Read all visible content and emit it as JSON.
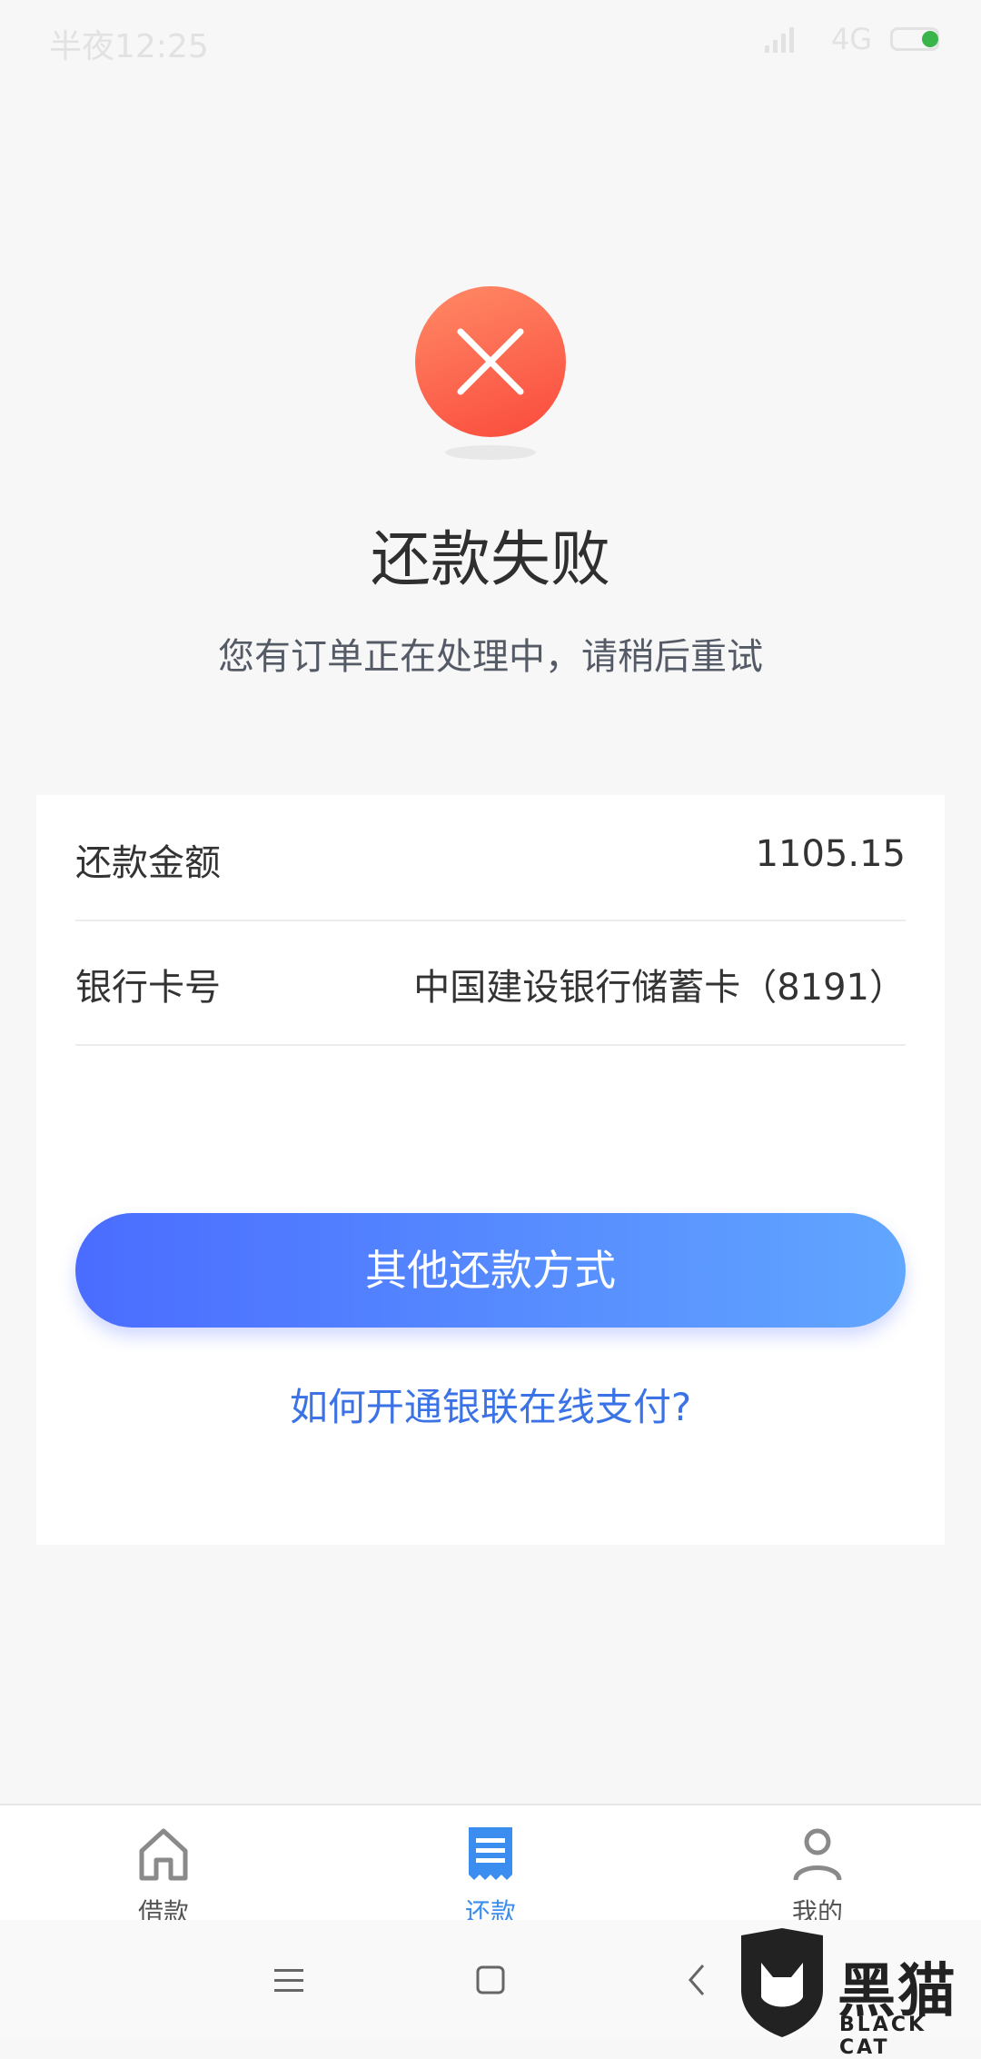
{
  "status_bar": {
    "time": "半夜12:25",
    "network": "4G"
  },
  "result": {
    "title": "还款失败",
    "subtitle": "您有订单正在处理中，请稍后重试",
    "icon": "close-icon",
    "icon_color": "#fa4a3c"
  },
  "details": {
    "rows": [
      {
        "label": "还款金额",
        "value": "1105.15"
      },
      {
        "label": "银行卡号",
        "value": "中国建设银行储蓄卡（8191）"
      }
    ]
  },
  "actions": {
    "primary_label": "其他还款方式",
    "help_link": "如何开通银联在线支付?"
  },
  "tab_bar": {
    "items": [
      {
        "label": "借款",
        "icon": "home-icon",
        "active": false
      },
      {
        "label": "还款",
        "icon": "bill-icon",
        "active": true
      },
      {
        "label": "我的",
        "icon": "user-icon",
        "active": false
      }
    ],
    "active_color": "#3b8df0"
  },
  "watermark": {
    "text": "黑猫",
    "subtext": "BLACK CAT"
  }
}
